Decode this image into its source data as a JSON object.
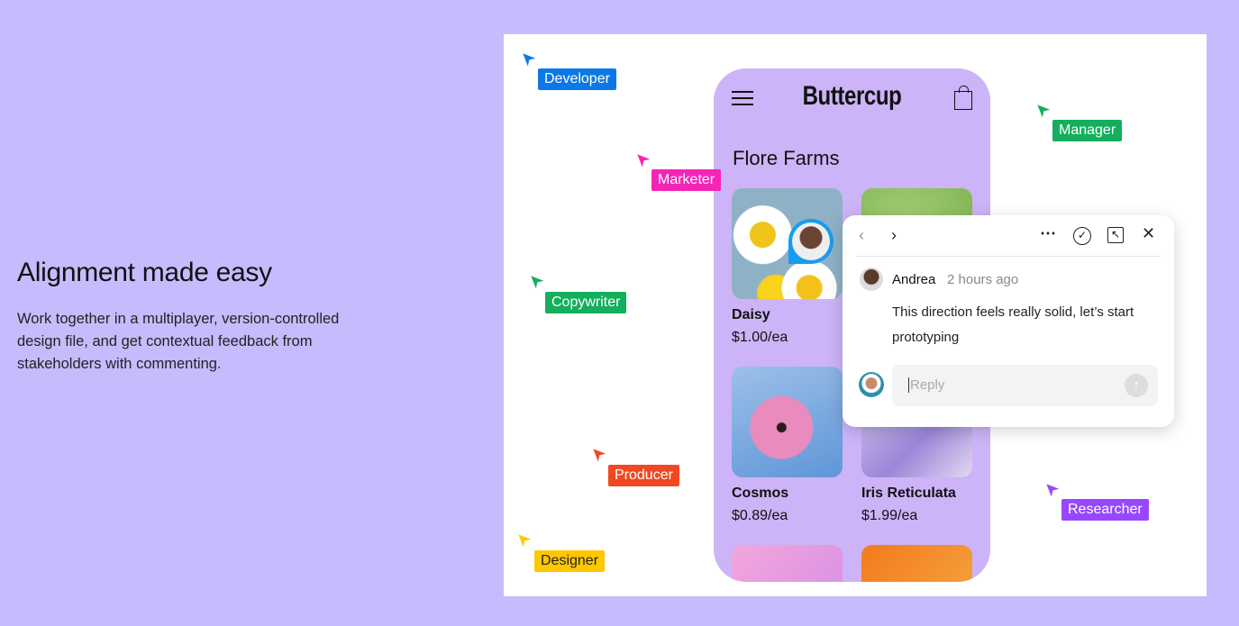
{
  "hero": {
    "title": "Alignment made easy",
    "description": "Work together in a multiplayer, version-controlled design file, and get contextual feedback from stakeholders with commenting."
  },
  "app": {
    "brand": "Buttercup",
    "store": "Flore Farms",
    "products": [
      {
        "name": "Daisy",
        "price": "$1.00/ea"
      },
      {
        "name": "Cosmos",
        "price": "$0.89/ea"
      },
      {
        "name": "Iris Reticulata",
        "price": "$1.99/ea"
      }
    ]
  },
  "comment": {
    "author": "Andrea",
    "time": "2 hours ago",
    "text": "This direction feels really solid, let’s start prototyping",
    "reply_placeholder": "Reply"
  },
  "cursors": [
    {
      "label": "Developer",
      "color": "#0c78e6"
    },
    {
      "label": "Marketer",
      "color": "#f524b6"
    },
    {
      "label": "Manager",
      "color": "#14ae5c"
    },
    {
      "label": "Copywriter",
      "color": "#14ae5c"
    },
    {
      "label": "Producer",
      "color": "#f24822"
    },
    {
      "label": "Designer",
      "color": "#ffc700"
    },
    {
      "label": "Researcher",
      "color": "#9747ff"
    }
  ]
}
